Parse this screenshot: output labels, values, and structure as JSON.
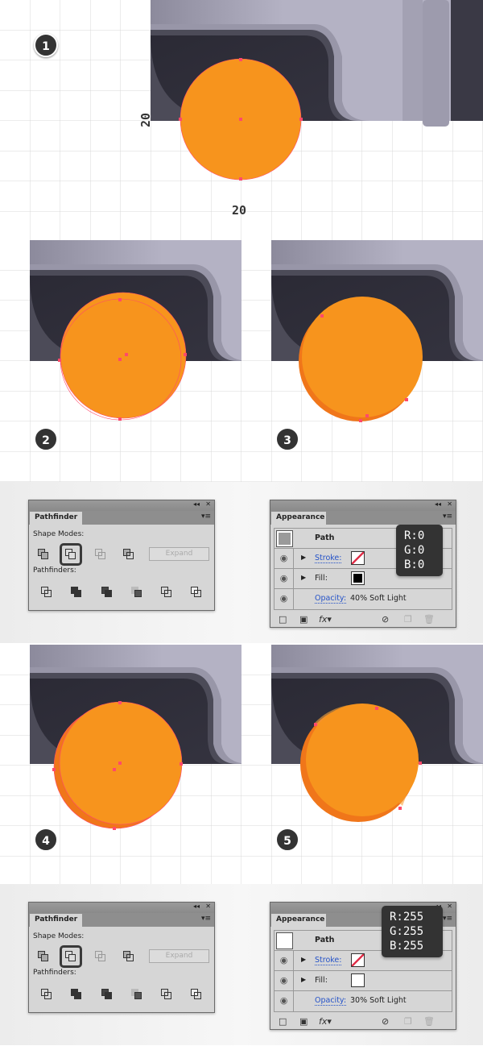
{
  "colors": {
    "orange": "#f7941d",
    "orange_dark": "#f0761a",
    "anchor": "#ff4a6a",
    "grid": "#d8d8d8",
    "badge": "#333333"
  },
  "steps": {
    "s1": "1",
    "s2": "2",
    "s3": "3",
    "s4": "4",
    "s5": "5"
  },
  "dimensions": {
    "height": "20",
    "width": "20"
  },
  "pathfinder": [
    {
      "title": "Pathfinder",
      "shape_modes": "Shape Modes:",
      "pathfinders": "Pathfinders:",
      "expand": "Expand",
      "selected_mode": "minus-front"
    },
    {
      "title": "Pathfinder",
      "shape_modes": "Shape Modes:",
      "pathfinders": "Pathfinders:",
      "expand": "Expand",
      "selected_mode": "minus-front"
    }
  ],
  "appearance": [
    {
      "title": "Appearance",
      "path": "Path",
      "stroke": "Stroke:",
      "fill": "Fill:",
      "opacity": "Opacity:",
      "opacity_value": "40% Soft Light",
      "fill_color": "#000000",
      "swatch_color": "#9a9a9a",
      "tooltip": {
        "r": "R:0",
        "g": "G:0",
        "b": "B:0"
      }
    },
    {
      "title": "Appearance",
      "path": "Path",
      "stroke": "Stroke:",
      "fill": "Fill:",
      "opacity": "Opacity:",
      "opacity_value": "30% Soft Light",
      "fill_color": "#ffffff",
      "swatch_color": "#ffffff",
      "tooltip": {
        "r": "R:255",
        "g": "G:255",
        "b": "B:255"
      }
    }
  ]
}
